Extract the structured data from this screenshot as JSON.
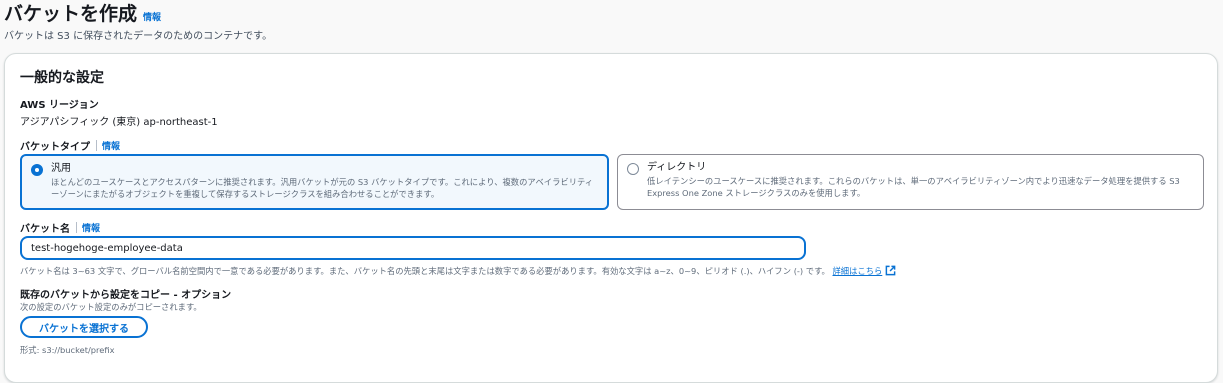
{
  "header": {
    "title": "バケットを作成",
    "info": "情報",
    "description": "バケットは S3 に保存されたデータのためのコンテナです。"
  },
  "general": {
    "title": "一般的な設定",
    "region_label": "AWS リージョン",
    "region_value": "アジアパシフィック (東京) ap-northeast-1",
    "bucket_type_label": "バケットタイプ",
    "bucket_type_info": "情報",
    "bucket_types": [
      {
        "title": "汎用",
        "description": "ほとんどのユースケースとアクセスパターンに推奨されます。汎用バケットが元の S3 バケットタイプです。これにより、複数のアベイラビリティーゾーンにまたがるオブジェクトを重複して保存するストレージクラスを組み合わせることができます。",
        "selected": true
      },
      {
        "title": "ディレクトリ",
        "description": "低レイテンシーのユースケースに推奨されます。これらのバケットは、単一のアベイラビリティゾーン内でより迅速なデータ処理を提供する S3 Express One Zone ストレージクラスのみを使用します。",
        "selected": false
      }
    ],
    "bucket_name_label": "バケット名",
    "bucket_name_info": "情報",
    "bucket_name_value": "test-hogehoge-employee-data",
    "bucket_name_hint": "バケット名は 3~63 文字で、グローバル名前空間内で一意である必要があります。また、バケット名の先頭と末尾は文字または数字である必要があります。有効な文字は a~z、0~9、ピリオド (.)、ハイフン (-) です。",
    "bucket_name_hint_link": "詳細はこちら",
    "copy_label": "既存のバケットから設定をコピー - オプション",
    "copy_desc": "次の設定のバケット設定のみがコピーされます。",
    "choose_button": "バケットを選択する",
    "format_hint": "形式: s3://bucket/prefix"
  },
  "colors": {
    "accent": "#0972d3",
    "text": "#16191f",
    "muted": "#5f6b7a"
  }
}
